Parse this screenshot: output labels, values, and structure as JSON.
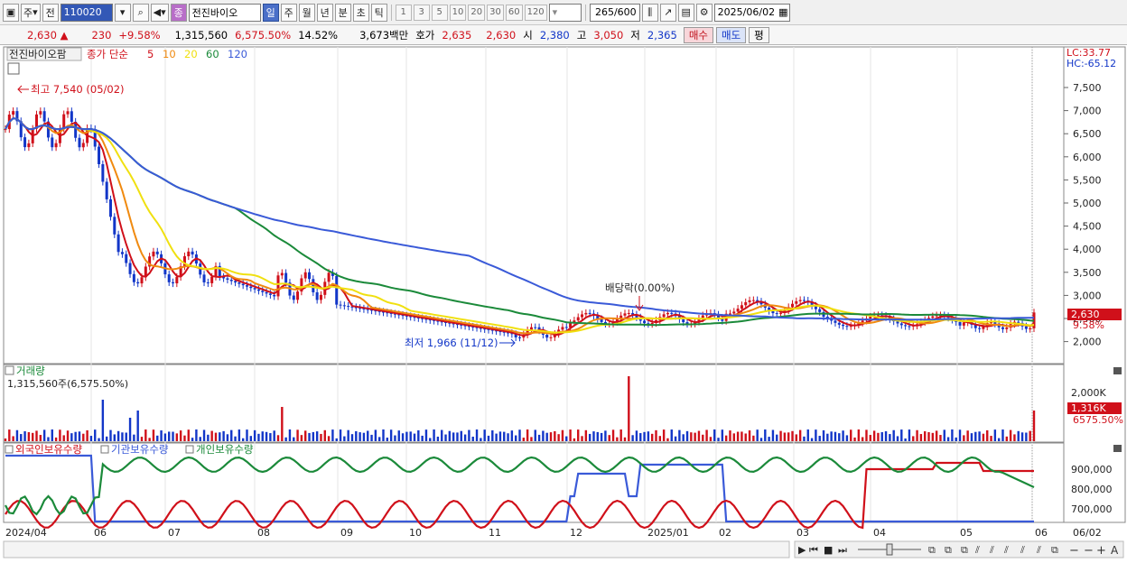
{
  "toolbar": {
    "market_btn": "주",
    "prev_btn": "전",
    "code": "110020",
    "stock_name": "전진바이오",
    "stock_badge": "종",
    "periods": [
      "일",
      "주",
      "월",
      "년",
      "분",
      "초",
      "틱"
    ],
    "numbers": [
      "1",
      "3",
      "5",
      "10",
      "20",
      "30",
      "60",
      "120"
    ],
    "count": "265",
    "count_total": "/600",
    "date": "2025/06/02"
  },
  "quote": {
    "price": "2,630",
    "change": "230",
    "rate": "+9.58%",
    "volume": "1,315,560",
    "vol_rate": "6,575.50%",
    "turnover": "14.52%",
    "amount": "3,673백만",
    "hoga_label": "호가",
    "hoga1": "2,635",
    "hoga2": "2,630",
    "open_label": "시",
    "open": "2,380",
    "high_label": "고",
    "high": "3,050",
    "low_label": "저",
    "low": "2,365",
    "buy_btn": "매수",
    "sell_btn": "매도",
    "eval_btn": "평"
  },
  "price_panel": {
    "stock": "전진바이오팜",
    "legend_prefix": "종가 단순",
    "ma": [
      {
        "label": "5",
        "color": "#d0101a"
      },
      {
        "label": "10",
        "color": "#f08a10"
      },
      {
        "label": "20",
        "color": "#f0e010"
      },
      {
        "label": "60",
        "color": "#1b8a3a"
      },
      {
        "label": "120",
        "color": "#3a5ad8"
      }
    ],
    "lc": "LC:33.77",
    "hc": "HC:-65.12",
    "y_ticks": [
      "7,500",
      "7,000",
      "6,500",
      "6,000",
      "5,500",
      "5,000",
      "4,500",
      "4,000",
      "3,500",
      "3,000",
      "2,500",
      "2,000"
    ],
    "high_note": "최고 7,540 (05/02)",
    "low_note": "최저 1,966 (11/12)",
    "dividend_note": "배당락(0.00%)",
    "price_tag": "2,630",
    "rate_tag": "9.58%"
  },
  "volume_panel": {
    "title": "거래량",
    "subtitle": "1,315,560주(6,575.50%)",
    "y_tick": "2,000K",
    "tag": "1,316K",
    "rate_tag": "6575.50%"
  },
  "holding_panel": {
    "legends": [
      {
        "label": "외국인보유수량",
        "color": "#d0101a"
      },
      {
        "label": "기관보유수량",
        "color": "#3a5ad8"
      },
      {
        "label": "개인보유수량",
        "color": "#1b8a3a"
      }
    ],
    "y_ticks": [
      "900,000",
      "800,000",
      "700,000"
    ]
  },
  "x_axis": {
    "labels": [
      "2024/04",
      "06",
      "07",
      "08",
      "09",
      "10",
      "11",
      "12",
      "2025/01",
      "02",
      "03",
      "04",
      "05",
      "06",
      "06/02"
    ]
  },
  "colors": {
    "up": "#d0101a",
    "down": "#1236c8",
    "ma5": "#d0101a",
    "ma10": "#f08a10",
    "ma20": "#f0e010",
    "ma60": "#1b8a3a",
    "ma120": "#3a5ad8"
  }
}
